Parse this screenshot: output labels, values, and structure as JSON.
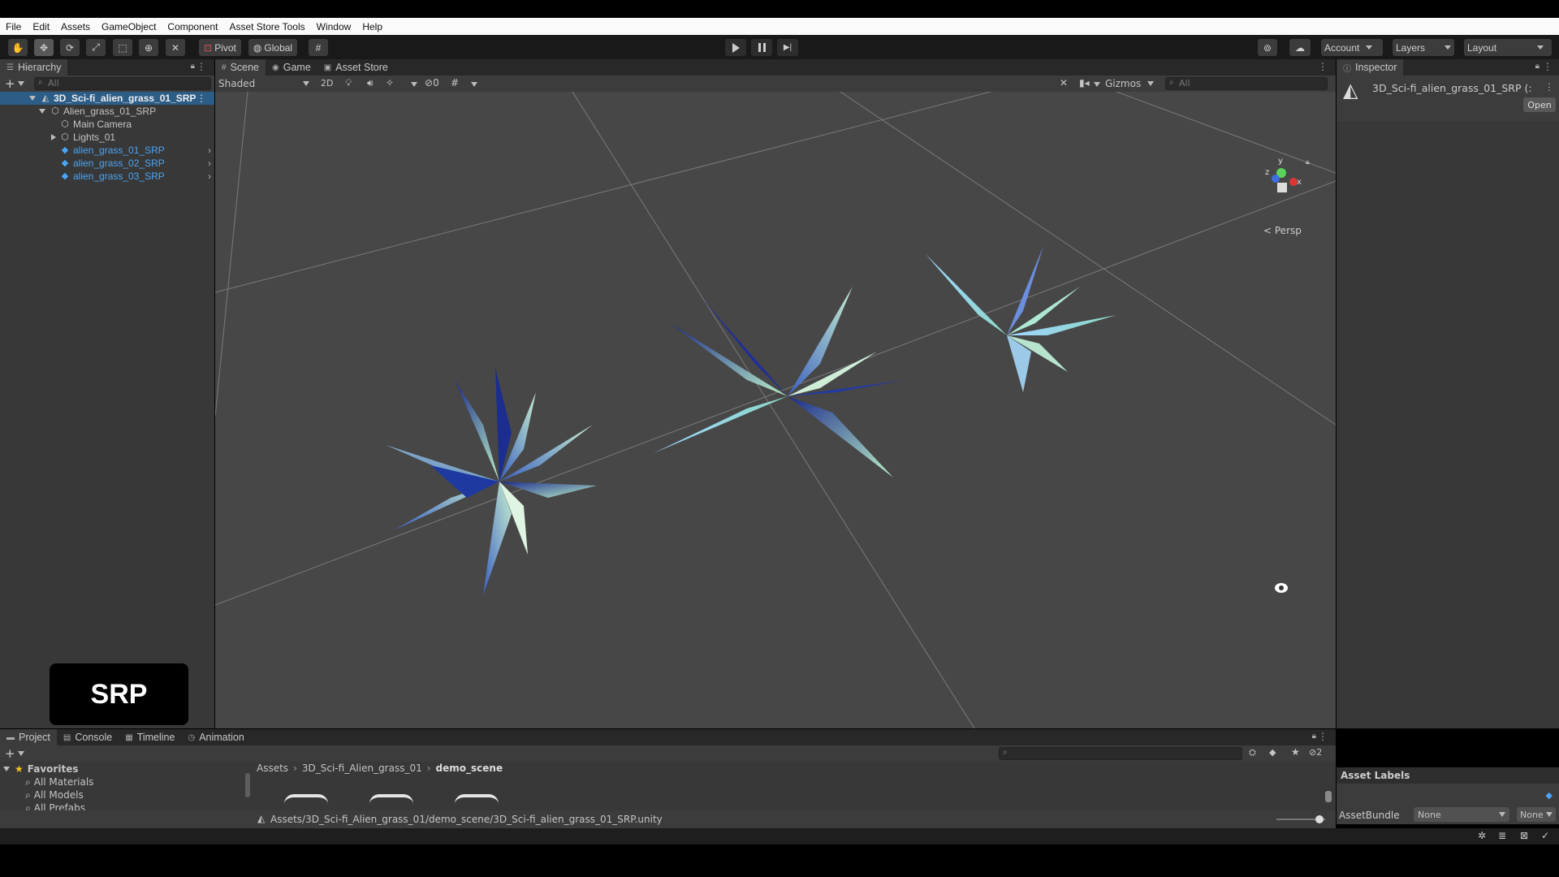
{
  "menu": [
    "File",
    "Edit",
    "Assets",
    "GameObject",
    "Component",
    "Asset Store Tools",
    "Window",
    "Help"
  ],
  "toolbar": {
    "pivot": "Pivot",
    "global": "Global",
    "account": "Account",
    "layers": "Layers",
    "layout": "Layout"
  },
  "hierarchy": {
    "tab": "Hierarchy",
    "search_placeholder": "All",
    "scene_name": "3D_Sci-fi_alien_grass_01_SRP",
    "items": [
      {
        "label": "Alien_grass_01_SRP"
      },
      {
        "label": "Main Camera"
      },
      {
        "label": "Lights_01"
      },
      {
        "label": "alien_grass_01_SRP"
      },
      {
        "label": "alien_grass_02_SRP"
      },
      {
        "label": "alien_grass_03_SRP"
      }
    ],
    "overlay_text": "SRP"
  },
  "scene_view": {
    "tabs": [
      "Scene",
      "Game",
      "Asset Store"
    ],
    "shading": "Shaded",
    "mode_2d": "2D",
    "hidden_count": "0",
    "gizmos": "Gizmos",
    "search_placeholder": "All",
    "projection": "Persp",
    "axis_labels": {
      "x": "x",
      "y": "y",
      "z": "z"
    }
  },
  "inspector": {
    "tab": "Inspector",
    "object_name": "3D_Sci-fi_alien_grass_01_SRP (:",
    "open_button": "Open",
    "asset_labels": "Asset Labels",
    "assetbundle_label": "AssetBundle",
    "assetbundle_value": "None",
    "variant_value": "None"
  },
  "bottom": {
    "tabs": [
      "Project",
      "Console",
      "Timeline",
      "Animation"
    ],
    "favorites": "Favorites",
    "favorite_items": [
      "All Materials",
      "All Models",
      "All Prefabs"
    ],
    "breadcrumb": [
      "Assets",
      "3D_Sci-fi_Alien_grass_01",
      "demo_scene"
    ],
    "selected_path": "Assets/3D_Sci-fi_Alien_grass_01/demo_scene/3D_Sci-fi_alien_grass_01_SRP.unity",
    "hidden_count": "2"
  },
  "colors": {
    "selection": "#2c5d87",
    "link_blue": "#4ba5f5",
    "scene_bg": "#474747",
    "panel_bg": "#383838"
  }
}
